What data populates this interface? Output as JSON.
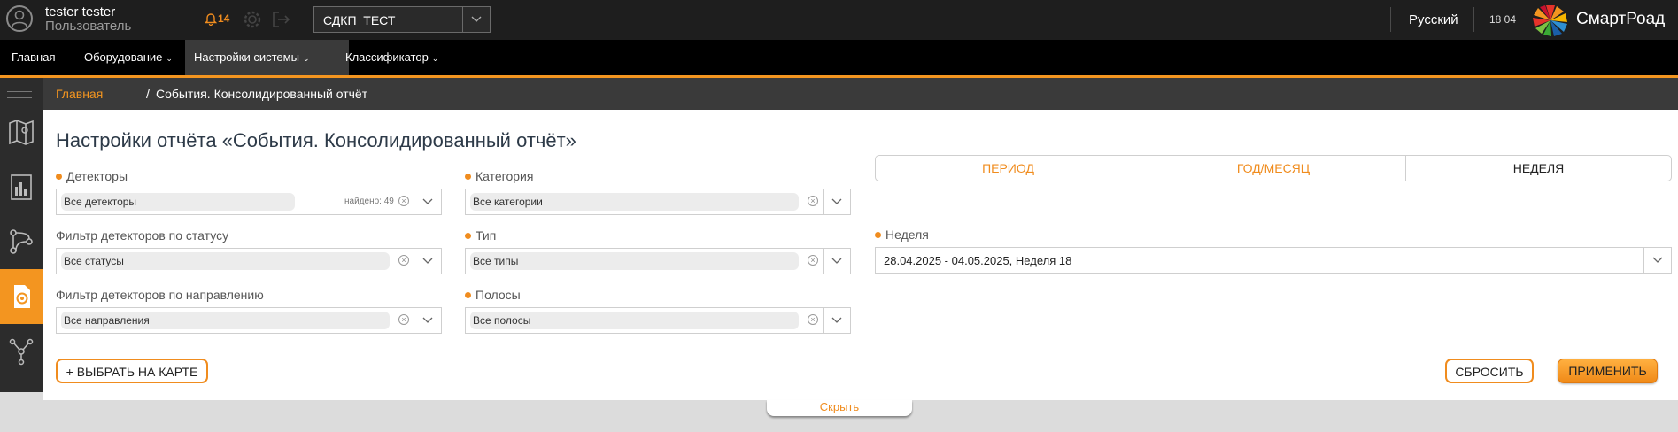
{
  "user": {
    "name": "tester tester",
    "role": "Пользователь"
  },
  "notifications": {
    "count": "14"
  },
  "project": {
    "selected": "СДКП_ТЕСТ"
  },
  "language": "Русский",
  "clock": "18 04",
  "brand": {
    "name": "СмартРоад"
  },
  "menu": {
    "items": [
      {
        "label": "Главная"
      },
      {
        "label": "Оборудование"
      },
      {
        "label": "Настройки системы"
      },
      {
        "label": "Классификатор"
      }
    ]
  },
  "breadcrumb": {
    "home": "Главная",
    "separator": "/",
    "current": "События. Консолидированный отчёт"
  },
  "page": {
    "title": "Настройки отчёта «События. Консолидированный отчёт»"
  },
  "filters": {
    "detectors": {
      "label": "Детекторы",
      "value": "Все детекторы",
      "found": "найдено: 49"
    },
    "status": {
      "label": "Фильтр детекторов по статусу",
      "value": "Все статусы"
    },
    "direction": {
      "label": "Фильтр детекторов по направлению",
      "value": "Все направления"
    },
    "category": {
      "label": "Категория",
      "value": "Все категории"
    },
    "type": {
      "label": "Тип",
      "value": "Все типы"
    },
    "lanes": {
      "label": "Полосы",
      "value": "Все полосы"
    }
  },
  "period": {
    "options": [
      "ПЕРИОД",
      "ГОД/МЕСЯЦ",
      "НЕДЕЛЯ"
    ],
    "selected": "НЕДЕЛЯ",
    "week_label": "Неделя",
    "week_value": "28.04.2025 - 04.05.2025, Неделя 18"
  },
  "actions": {
    "select_on_map": "+ ВЫБРАТЬ НА КАРТЕ",
    "reset": "СБРОСИТЬ",
    "apply": "ПРИМЕНИТЬ",
    "hide": "Скрыть"
  },
  "colors": {
    "accent": "#f39520",
    "topbar": "#1e1e1e",
    "menubar": "#000000",
    "sidebar": "#2c2c2c"
  }
}
